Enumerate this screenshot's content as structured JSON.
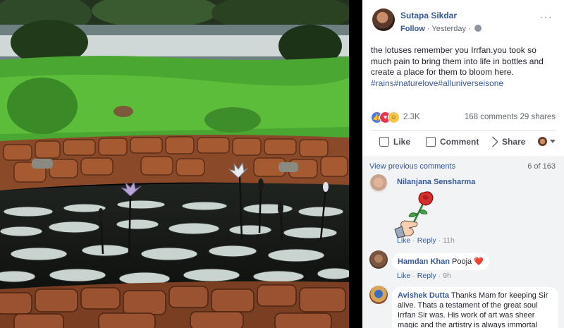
{
  "post": {
    "author": "Sutapa Sikdar",
    "follow": "Follow",
    "time": "Yesterday",
    "separator": "·",
    "text": "the lotuses remember you Irrfan.you took so much pain to bring them into life in bottles and create a place for them to bloom here.",
    "hashtags": "#rains#naturelove#alluniverseisone"
  },
  "reactions": {
    "count": "2.3K",
    "comments": "168 comments",
    "shares": "29 shares",
    "icons": [
      "like-icon",
      "love-icon",
      "haha-icon"
    ]
  },
  "actions": {
    "like": "Like",
    "comment": "Comment",
    "share": "Share"
  },
  "comments_section": {
    "view_previous": "View previous comments",
    "count": "6 of 163",
    "items": [
      {
        "name": "Nilanjana Sensharma",
        "text": "",
        "sticker": "hand-holding-rose-sticker",
        "like": "Like",
        "reply": "Reply",
        "time": "11h"
      },
      {
        "name": "Hamdan Khan",
        "text": "Pooja ❤️",
        "like": "Like",
        "reply": "Reply",
        "time": "9h"
      },
      {
        "name": "Avishek Dutta",
        "text": "Thanks Mam for keeping Sir alive. Thats a testament of the great soul Irrfan Sir was. His work of art was sheer magic and the artistry is always immortal"
      }
    ]
  },
  "colors": {
    "link": "#365899",
    "panel_bg": "#ffffff",
    "comments_bg": "#f2f3f5"
  }
}
